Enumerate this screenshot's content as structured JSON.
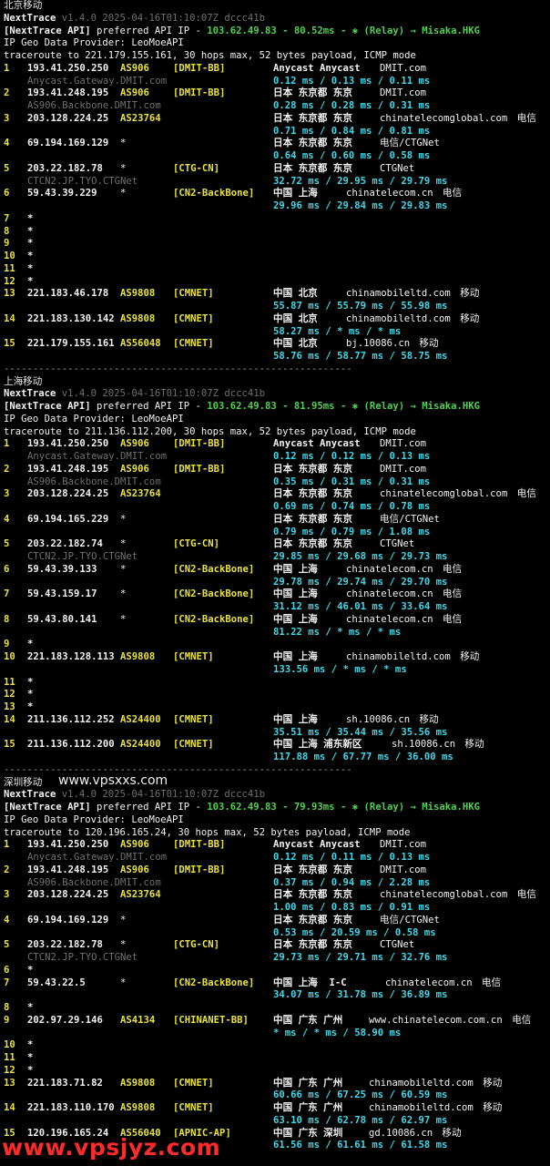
{
  "watermarks": {
    "inline": "www.vpsxxs.com",
    "bottom": "www.vpsjyz.com"
  },
  "separator": "------------------------------------------------------------",
  "sections": [
    {
      "title": "北京移动",
      "header": {
        "tool": "NextTrace",
        "version": "v1.4.0 2025-04-16T01:10:07Z dccc41b",
        "api_prefix": "[NextTrace API]",
        "api_text": " preferred API IP - ",
        "api_ip": "103.62.49.83",
        "latency": " - 80.52ms - ",
        "relay_icon": "✱",
        "relay": " (Relay) → Misaka.HKG",
        "geo_provider": "IP Geo Data Provider: LeoMoeAPI",
        "traceroute": "traceroute to 221.179.155.161, 30 hops max, 52 bytes payload, ICMP mode"
      },
      "hops": [
        {
          "n": "1",
          "ip": "193.41.250.250",
          "asn": "AS906",
          "tag": "[DMIT-BB]",
          "geo": "Anycast Anycast",
          "host": "DMIT.com",
          "carrier": "",
          "rdns": "Anycast.Gateway.DMIT.com",
          "rtt": "0.12 ms / 0.13 ms / 0.11 ms"
        },
        {
          "n": "2",
          "ip": "193.41.248.195",
          "asn": "AS906",
          "tag": "[DMIT-BB]",
          "geo": "日本 东京都 东京",
          "host": "DMIT.com",
          "carrier": "",
          "rdns": "AS906.Backbone.DMIT.com",
          "rtt": "0.28 ms / 0.28 ms / 0.31 ms"
        },
        {
          "n": "3",
          "ip": "203.128.224.25",
          "asn": "AS23764",
          "tag": "",
          "geo": "日本 东京都 东京",
          "host": "chinatelecomglobal.com",
          "carrier": "电信",
          "rdns": "",
          "rtt": "0.71 ms / 0.84 ms / 0.81 ms"
        },
        {
          "n": "4",
          "ip": "69.194.169.129",
          "asn": "*",
          "tag": "",
          "geo": "日本 东京都 东京",
          "host": "电信/CTGNet",
          "carrier": "",
          "rdns": "",
          "rtt": "0.64 ms / 0.60 ms / 0.58 ms"
        },
        {
          "n": "5",
          "ip": "203.22.182.78",
          "asn": "*",
          "tag": "[CTG-CN]",
          "geo": "日本 东京都 东京",
          "host": "CTGNet",
          "carrier": "",
          "rdns": "CTCN2.JP.TYO.CTGNet",
          "rtt": "32.72 ms / 29.95 ms / 29.79 ms"
        },
        {
          "n": "6",
          "ip": "59.43.39.229",
          "asn": "*",
          "tag": "[CN2-BackBone]",
          "geo": "中国 上海",
          "host": "chinatelecom.cn",
          "carrier": "电信",
          "rdns": "",
          "rtt": "29.96 ms / 29.84 ms / 29.83 ms"
        },
        {
          "n": "7",
          "ip": "*"
        },
        {
          "n": "8",
          "ip": "*"
        },
        {
          "n": "9",
          "ip": "*"
        },
        {
          "n": "10",
          "ip": "*"
        },
        {
          "n": "11",
          "ip": "*"
        },
        {
          "n": "12",
          "ip": "*"
        },
        {
          "n": "13",
          "ip": "221.183.46.178",
          "asn": "AS9808",
          "tag": "[CMNET]",
          "geo": "中国 北京",
          "host": "chinamobileltd.com",
          "carrier": "移动",
          "rdns": "",
          "rtt": "55.87 ms / 55.79 ms / 55.98 ms"
        },
        {
          "n": "14",
          "ip": "221.183.130.142",
          "asn": "AS9808",
          "tag": "[CMNET]",
          "geo": "中国 北京",
          "host": "chinamobileltd.com",
          "carrier": "移动",
          "rdns": "",
          "rtt": "58.27 ms / * ms / * ms"
        },
        {
          "n": "15",
          "ip": "221.179.155.161",
          "asn": "AS56048",
          "tag": "[CMNET]",
          "geo": "中国 北京",
          "host": "bj.10086.cn",
          "carrier": "移动",
          "rdns": "",
          "rtt": "58.76 ms / 58.77 ms / 58.75 ms"
        }
      ]
    },
    {
      "title": "上海移动",
      "header": {
        "tool": "NextTrace",
        "version": "v1.4.0 2025-04-16T01:10:07Z dccc41b",
        "api_prefix": "[NextTrace API]",
        "api_text": " preferred API IP - ",
        "api_ip": "103.62.49.83",
        "latency": " - 81.95ms - ",
        "relay_icon": "✱",
        "relay": " (Relay) → Misaka.HKG",
        "geo_provider": "IP Geo Data Provider: LeoMoeAPI",
        "traceroute": "traceroute to 211.136.112.200, 30 hops max, 52 bytes payload, ICMP mode"
      },
      "hops": [
        {
          "n": "1",
          "ip": "193.41.250.250",
          "asn": "AS906",
          "tag": "[DMIT-BB]",
          "geo": "Anycast Anycast",
          "host": "DMIT.com",
          "carrier": "",
          "rdns": "Anycast.Gateway.DMIT.com",
          "rtt": "0.12 ms / 0.12 ms / 0.13 ms"
        },
        {
          "n": "2",
          "ip": "193.41.248.195",
          "asn": "AS906",
          "tag": "[DMIT-BB]",
          "geo": "日本 东京都 东京",
          "host": "DMIT.com",
          "carrier": "",
          "rdns": "AS906.Backbone.DMIT.com",
          "rtt": "0.35 ms / 0.31 ms / 0.31 ms"
        },
        {
          "n": "3",
          "ip": "203.128.224.25",
          "asn": "AS23764",
          "tag": "",
          "geo": "日本 东京都 东京",
          "host": "chinatelecomglobal.com",
          "carrier": "电信",
          "rdns": "",
          "rtt": "0.69 ms / 0.74 ms / 0.78 ms"
        },
        {
          "n": "4",
          "ip": "69.194.165.229",
          "asn": "*",
          "tag": "",
          "geo": "日本 东京都 东京",
          "host": "电信/CTGNet",
          "carrier": "",
          "rdns": "",
          "rtt": "0.79 ms / 0.79 ms / 1.08 ms"
        },
        {
          "n": "5",
          "ip": "203.22.182.74",
          "asn": "*",
          "tag": "[CTG-CN]",
          "geo": "日本 东京都 东京",
          "host": "CTGNet",
          "carrier": "",
          "rdns": "CTCN2.JP.TYO.CTGNet",
          "rtt": "29.85 ms / 29.68 ms / 29.73 ms"
        },
        {
          "n": "6",
          "ip": "59.43.39.133",
          "asn": "*",
          "tag": "[CN2-BackBone]",
          "geo": "中国 上海",
          "host": "chinatelecom.cn",
          "carrier": "电信",
          "rdns": "",
          "rtt": "29.78 ms / 29.74 ms / 29.70 ms"
        },
        {
          "n": "7",
          "ip": "59.43.159.17",
          "asn": "*",
          "tag": "[CN2-BackBone]",
          "geo": "中国 上海",
          "host": "chinatelecom.cn",
          "carrier": "电信",
          "rdns": "",
          "rtt": "31.12 ms / 46.01 ms / 33.64 ms"
        },
        {
          "n": "8",
          "ip": "59.43.80.141",
          "asn": "*",
          "tag": "[CN2-BackBone]",
          "geo": "中国 上海",
          "host": "chinatelecom.cn",
          "carrier": "电信",
          "rdns": "",
          "rtt": "81.22 ms / * ms / * ms"
        },
        {
          "n": "9",
          "ip": "*"
        },
        {
          "n": "10",
          "ip": "221.183.128.113",
          "asn": "AS9808",
          "tag": "[CMNET]",
          "geo": "中国 上海",
          "host": "chinamobileltd.com",
          "carrier": "移动",
          "rdns": "",
          "rtt": "133.56 ms / * ms / * ms"
        },
        {
          "n": "11",
          "ip": "*"
        },
        {
          "n": "12",
          "ip": "*"
        },
        {
          "n": "13",
          "ip": "*"
        },
        {
          "n": "14",
          "ip": "211.136.112.252",
          "asn": "AS24400",
          "tag": "[CMNET]",
          "geo": "中国 上海",
          "host": "sh.10086.cn",
          "carrier": "移动",
          "rdns": "",
          "rtt": "35.51 ms / 35.44 ms / 35.56 ms"
        },
        {
          "n": "15",
          "ip": "211.136.112.200",
          "asn": "AS24400",
          "tag": "[CMNET]",
          "geo": "中国 上海 浦东新区",
          "host": "sh.10086.cn",
          "carrier": "移动",
          "rdns": "",
          "rtt": "117.88 ms / 67.77 ms / 36.00 ms"
        }
      ]
    },
    {
      "title": "深圳移动",
      "header": {
        "tool": "NextTrace",
        "version": "v1.4.0 2025-04-16T01:10:07Z dccc41b",
        "api_prefix": "[NextTrace API]",
        "api_text": " preferred API IP - ",
        "api_ip": "103.62.49.83",
        "latency": " - 79.93ms - ",
        "relay_icon": "✱",
        "relay": " (Relay) → Misaka.HKG",
        "geo_provider": "IP Geo Data Provider: LeoMoeAPI",
        "traceroute": "traceroute to 120.196.165.24, 30 hops max, 52 bytes payload, ICMP mode"
      },
      "hops": [
        {
          "n": "1",
          "ip": "193.41.250.250",
          "asn": "AS906",
          "tag": "[DMIT-BB]",
          "geo": "Anycast Anycast",
          "host": "DMIT.com",
          "carrier": "",
          "rdns": "Anycast.Gateway.DMIT.com",
          "rtt": "0.12 ms / 0.11 ms / 0.13 ms"
        },
        {
          "n": "2",
          "ip": "193.41.248.195",
          "asn": "AS906",
          "tag": "[DMIT-BB]",
          "geo": "日本 东京都 东京",
          "host": "DMIT.com",
          "carrier": "",
          "rdns": "AS906.Backbone.DMIT.com",
          "rtt": "0.37 ms / 0.94 ms / 2.28 ms"
        },
        {
          "n": "3",
          "ip": "203.128.224.25",
          "asn": "AS23764",
          "tag": "",
          "geo": "日本 东京都 东京",
          "host": "chinatelecomglobal.com",
          "carrier": "电信",
          "rdns": "",
          "rtt": "1.00 ms / 0.83 ms / 0.91 ms"
        },
        {
          "n": "4",
          "ip": "69.194.169.129",
          "asn": "*",
          "tag": "",
          "geo": "日本 东京都 东京",
          "host": "电信/CTGNet",
          "carrier": "",
          "rdns": "",
          "rtt": "0.53 ms / 20.59 ms / 0.58 ms"
        },
        {
          "n": "5",
          "ip": "203.22.182.78",
          "asn": "*",
          "tag": "[CTG-CN]",
          "geo": "日本 东京都 东京",
          "host": "CTGNet",
          "carrier": "",
          "rdns": "CTCN2.JP.TYO.CTGNet",
          "rtt": "29.73 ms / 29.71 ms / 32.76 ms"
        },
        {
          "n": "6",
          "ip": "*"
        },
        {
          "n": "7",
          "ip": "59.43.22.5",
          "asn": "*",
          "tag": "[CN2-BackBone]",
          "geo": "中国 上海  I-C",
          "host": "chinatelecom.cn",
          "carrier": "电信",
          "rdns": "",
          "rtt": "34.07 ms / 31.78 ms / 36.89 ms"
        },
        {
          "n": "8",
          "ip": "*"
        },
        {
          "n": "9",
          "ip": "202.97.29.146",
          "asn": "AS4134",
          "tag": "[CHINANET-BB]",
          "geo": "中国 广东 广州",
          "host": "www.chinatelecom.com.cn",
          "carrier": "电信",
          "rdns": "",
          "rtt": "* ms / * ms / 58.90 ms"
        },
        {
          "n": "10",
          "ip": "*"
        },
        {
          "n": "11",
          "ip": "*"
        },
        {
          "n": "12",
          "ip": "*"
        },
        {
          "n": "13",
          "ip": "221.183.71.82",
          "asn": "AS9808",
          "tag": "[CMNET]",
          "geo": "中国 广东 广州",
          "host": "chinamobileltd.com",
          "carrier": "移动",
          "rdns": "",
          "rtt": "60.66 ms / 67.25 ms / 60.59 ms"
        },
        {
          "n": "14",
          "ip": "221.183.110.170",
          "asn": "AS9808",
          "tag": "[CMNET]",
          "geo": "中国 广东 广州",
          "host": "chinamobileltd.com",
          "carrier": "移动",
          "rdns": "",
          "rtt": "63.10 ms / 62.78 ms / 62.97 ms"
        },
        {
          "n": "15",
          "ip": "120.196.165.24",
          "asn": "AS56040",
          "tag": "[APNIC-AP]",
          "geo": "中国 广东 深圳",
          "host": "gd.10086.cn",
          "carrier": "移动",
          "rdns": "",
          "rtt": "61.56 ms / 61.61 ms / 61.58 ms"
        }
      ]
    }
  ]
}
